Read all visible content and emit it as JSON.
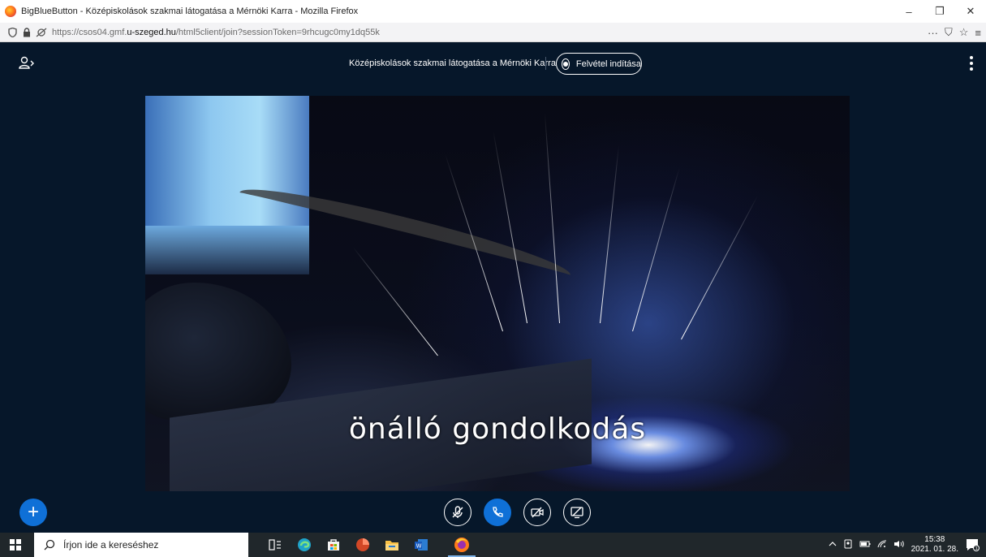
{
  "browser": {
    "window_title": "BigBlueButton - Középiskolások szakmai látogatása a Mérnöki Karra - Mozilla Firefox",
    "url_prefix": "https://csos04.gmf.",
    "url_domain": "u-szeged.hu",
    "url_suffix": "/html5client/join?sessionToken=9rhcugc0my1dq55k",
    "window_controls": {
      "minimize": "–",
      "restore": "❐",
      "close": "✕"
    },
    "nav_right": {
      "more": "···",
      "pocket": "⛉",
      "bookmark": "☆",
      "menu": "≡"
    }
  },
  "header": {
    "meeting_title": "Középiskolások szakmai látogatása a Mérnöki Karra",
    "record_label": "Felvétel indítása"
  },
  "video": {
    "caption": "önálló gondolkodás"
  },
  "actions": {
    "plus_label": "+"
  },
  "taskbar": {
    "search_placeholder": "Írjon ide a kereséshez",
    "time": "15:38",
    "date": "2021. 01. 28."
  },
  "colors": {
    "app_bg": "#06172a",
    "accent": "#0f70d7",
    "taskbar_bg": "#20272b"
  }
}
